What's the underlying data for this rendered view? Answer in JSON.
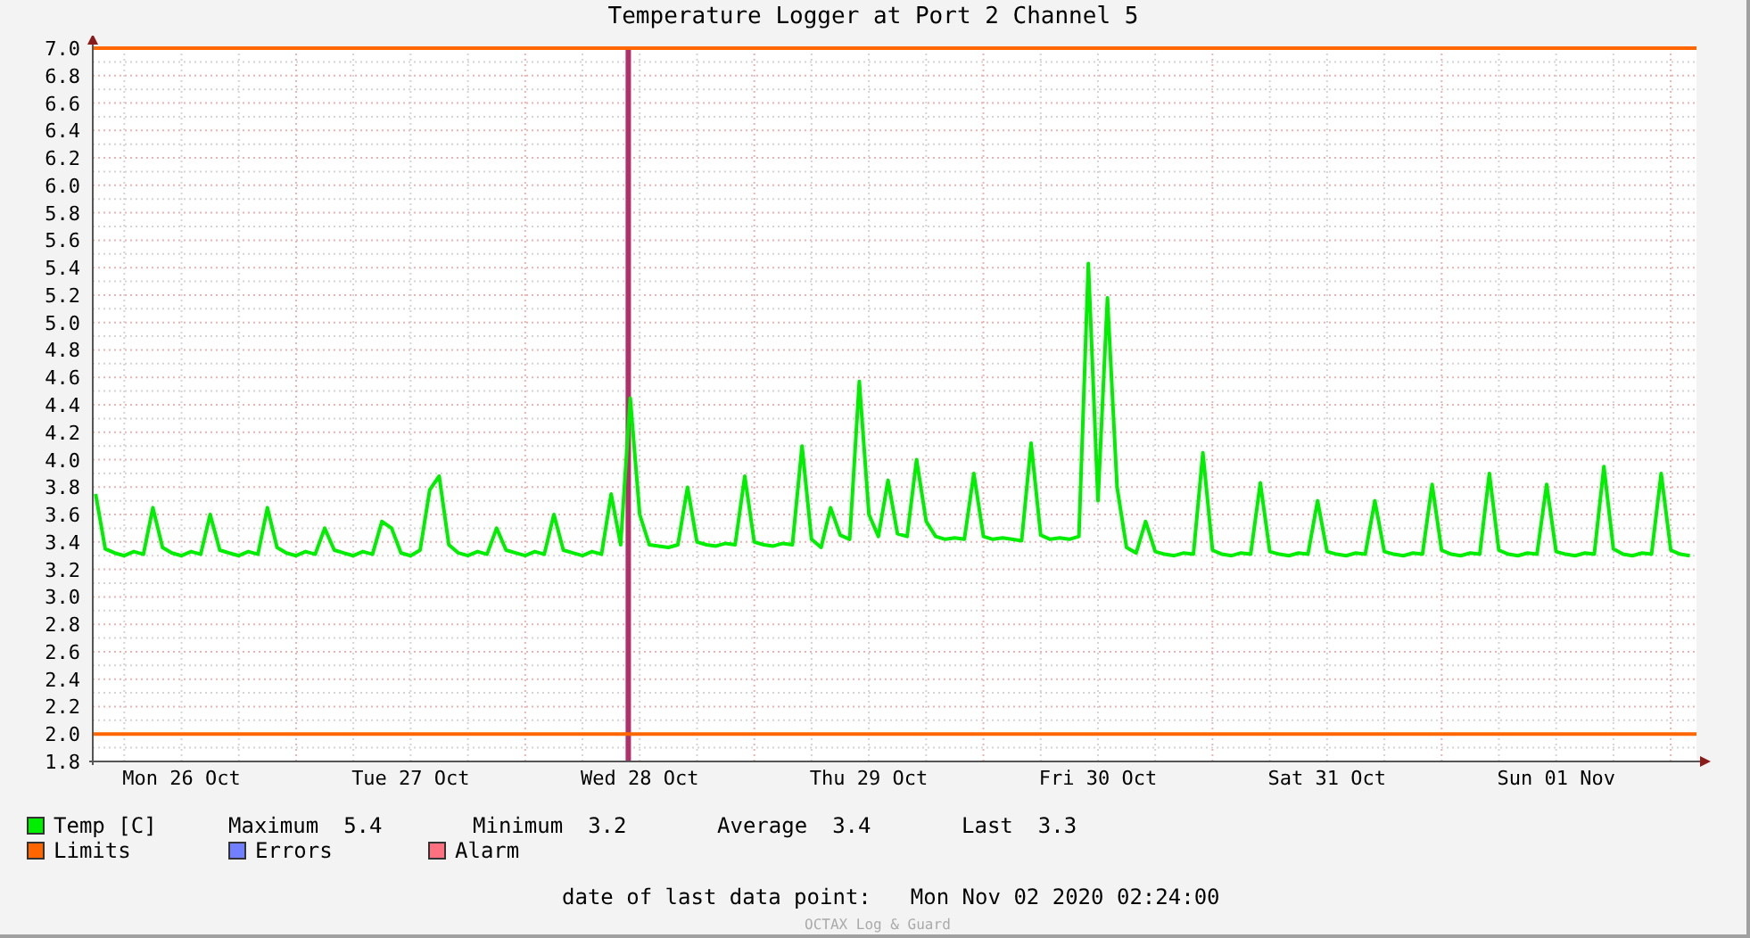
{
  "title": "Temperature Logger at Port 2 Channel 5",
  "chart_data": {
    "type": "line",
    "ylim": [
      1.8,
      7.0
    ],
    "yticks": [
      {
        "value": 1.8,
        "label": "1.8"
      },
      {
        "value": 2.0,
        "label": "2.0"
      },
      {
        "value": 2.2,
        "label": "2.2"
      },
      {
        "value": 2.4,
        "label": "2.4"
      },
      {
        "value": 2.6,
        "label": "2.6"
      },
      {
        "value": 2.8,
        "label": "2.8"
      },
      {
        "value": 3.0,
        "label": "3.0"
      },
      {
        "value": 3.2,
        "label": "3.2"
      },
      {
        "value": 3.4,
        "label": "3.4"
      },
      {
        "value": 3.6,
        "label": "3.6"
      },
      {
        "value": 3.8,
        "label": "3.8"
      },
      {
        "value": 4.0,
        "label": "4.0"
      },
      {
        "value": 4.2,
        "label": "4.2"
      },
      {
        "value": 4.4,
        "label": "4.4"
      },
      {
        "value": 4.6,
        "label": "4.6"
      },
      {
        "value": 4.8,
        "label": "4.8"
      },
      {
        "value": 5.0,
        "label": "5.0"
      },
      {
        "value": 5.2,
        "label": "5.2"
      },
      {
        "value": 5.4,
        "label": "5.4"
      },
      {
        "value": 5.6,
        "label": "5.6"
      },
      {
        "value": 5.8,
        "label": "5.8"
      },
      {
        "value": 6.0,
        "label": "6.0"
      },
      {
        "value": 6.2,
        "label": "6.2"
      },
      {
        "value": 6.4,
        "label": "6.4"
      },
      {
        "value": 6.6,
        "label": "6.6"
      },
      {
        "value": 6.8,
        "label": "6.8"
      },
      {
        "value": 7.0,
        "label": "7.0"
      }
    ],
    "categories": [
      null,
      null,
      null,
      null,
      null,
      null,
      null,
      null,
      null,
      "Mon 26 Oct",
      null,
      null,
      null,
      null,
      null,
      null,
      null,
      null,
      null,
      null,
      null,
      null,
      null,
      null,
      null,
      null,
      null,
      null,
      null,
      null,
      null,
      null,
      null,
      "Tue 27 Oct",
      null,
      null,
      null,
      null,
      null,
      null,
      null,
      null,
      null,
      null,
      null,
      null,
      null,
      null,
      null,
      null,
      null,
      null,
      null,
      null,
      null,
      null,
      null,
      "Wed 28 Oct",
      null,
      null,
      null,
      null,
      null,
      null,
      null,
      null,
      null,
      null,
      null,
      null,
      null,
      null,
      null,
      null,
      null,
      null,
      null,
      null,
      null,
      null,
      null,
      "Thu 29 Oct",
      null,
      null,
      null,
      null,
      null,
      null,
      null,
      null,
      null,
      null,
      null,
      null,
      null,
      null,
      null,
      null,
      null,
      null,
      null,
      null,
      null,
      null,
      null,
      "Fri 30 Oct",
      null,
      null,
      null,
      null,
      null,
      null,
      null,
      null,
      null,
      null,
      null,
      null,
      null,
      null,
      null,
      null,
      null,
      null,
      null,
      null,
      null,
      null,
      null,
      "Sat 31 Oct",
      null,
      null,
      null,
      null,
      null,
      null,
      null,
      null,
      null,
      null,
      null,
      null,
      null,
      null,
      null,
      null,
      null,
      null,
      null,
      null,
      null,
      null,
      null,
      "Sun 01 Nov",
      null,
      null,
      null,
      null,
      null,
      null,
      null,
      null,
      null,
      null,
      null,
      null,
      null,
      null
    ],
    "series": [
      {
        "name": "Temp [C]",
        "color": "#00ee00",
        "values": [
          3.75,
          3.35,
          3.32,
          3.3,
          3.33,
          3.31,
          3.65,
          3.36,
          3.32,
          3.3,
          3.33,
          3.31,
          3.6,
          3.34,
          3.32,
          3.3,
          3.33,
          3.31,
          3.65,
          3.36,
          3.32,
          3.3,
          3.33,
          3.31,
          3.5,
          3.34,
          3.32,
          3.3,
          3.33,
          3.31,
          3.55,
          3.5,
          3.32,
          3.3,
          3.34,
          3.78,
          3.88,
          3.38,
          3.32,
          3.3,
          3.33,
          3.31,
          3.5,
          3.34,
          3.32,
          3.3,
          3.33,
          3.31,
          3.6,
          3.34,
          3.32,
          3.3,
          3.33,
          3.31,
          3.75,
          3.38,
          4.45,
          3.6,
          3.38,
          3.37,
          3.36,
          3.38,
          3.8,
          3.4,
          3.38,
          3.37,
          3.39,
          3.38,
          3.88,
          3.4,
          3.38,
          3.37,
          3.39,
          3.38,
          4.1,
          3.42,
          3.36,
          3.65,
          3.45,
          3.42,
          4.57,
          3.6,
          3.44,
          3.85,
          3.46,
          3.44,
          4.0,
          3.55,
          3.44,
          3.42,
          3.43,
          3.42,
          3.9,
          3.44,
          3.42,
          3.43,
          3.42,
          3.41,
          4.12,
          3.45,
          3.42,
          3.43,
          3.42,
          3.44,
          5.43,
          3.7,
          5.18,
          3.8,
          3.36,
          3.32,
          3.55,
          3.33,
          3.31,
          3.3,
          3.32,
          3.31,
          4.05,
          3.34,
          3.31,
          3.3,
          3.32,
          3.31,
          3.83,
          3.33,
          3.31,
          3.3,
          3.32,
          3.31,
          3.7,
          3.33,
          3.31,
          3.3,
          3.32,
          3.31,
          3.7,
          3.33,
          3.31,
          3.3,
          3.32,
          3.31,
          3.82,
          3.34,
          3.31,
          3.3,
          3.32,
          3.31,
          3.9,
          3.34,
          3.31,
          3.3,
          3.32,
          3.31,
          3.82,
          3.33,
          3.31,
          3.3,
          3.32,
          3.31,
          3.95,
          3.35,
          3.31,
          3.3,
          3.32,
          3.31,
          3.9,
          3.34,
          3.31,
          3.3
        ]
      }
    ],
    "ref_lines": [
      {
        "axis": "y",
        "value": 7.0,
        "color": "#ff6600"
      },
      {
        "axis": "y",
        "value": 2.0,
        "color": "#ff6600"
      }
    ],
    "grid": true
  },
  "legend": [
    {
      "label": "Limits",
      "color": "#ff6600"
    },
    {
      "label": "Errors",
      "color": "#7080ff"
    },
    {
      "label": "Alarm",
      "color": "#ff7080"
    }
  ],
  "stats": [
    {
      "label": "Maximum",
      "value": "5.4"
    },
    {
      "label": "Minimum",
      "value": "3.2"
    },
    {
      "label": "Average",
      "value": "3.4"
    },
    {
      "label": "Last",
      "value": "3.3"
    }
  ],
  "last_data_point": {
    "label": "date of last data point:",
    "value": "Mon Nov 02 2020 02:24:00"
  },
  "credit": "OCTAX Log & Guard"
}
